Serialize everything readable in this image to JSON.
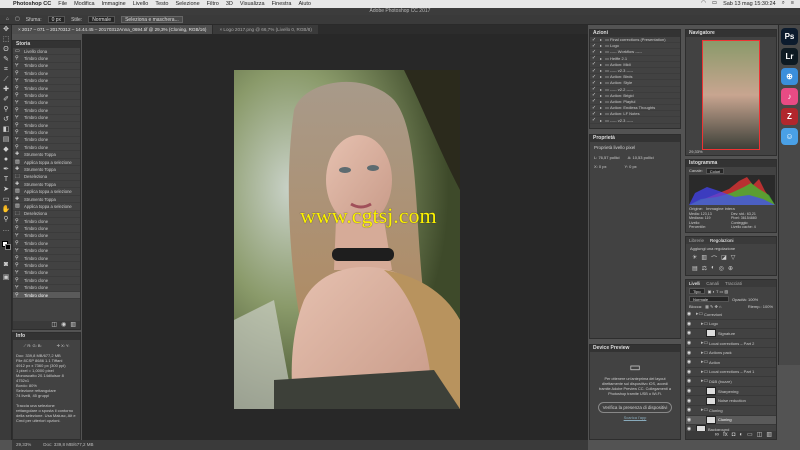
{
  "menubar": {
    "apple": "",
    "app_name": "Photoshop CC",
    "items": [
      "File",
      "Modifica",
      "Immagine",
      "Livello",
      "Testo",
      "Selezione",
      "Filtro",
      "3D",
      "Visualizza",
      "Finestra",
      "Aiuto"
    ],
    "clock": "Sab 13 mag  15:30:24"
  },
  "window_title": "Adobe Photoshop CC 2017",
  "options_bar": {
    "sfuma_label": "Sfuma:",
    "sfuma_value": "0 px",
    "stile_label": "Stile:",
    "stile_value": "Normale",
    "button": "Seleziona e maschera..."
  },
  "doc_tabs": [
    {
      "label": "2017 – 071 – 20170312 – 14.44.45 – 20170312Anna_0694.tif @ 29,3% (Cloning, RGB/16)",
      "active": true
    },
    {
      "label": "Logo 2017.png @ 66,7% (Livello 0, RGB/8)",
      "active": false
    }
  ],
  "history": {
    "title": "Storia",
    "items": [
      "Livello clona",
      "Timbro clone",
      "Timbro clone",
      "Timbro clone",
      "Timbro clone",
      "Timbro clone",
      "Timbro clone",
      "Timbro clone",
      "Timbro clone",
      "Timbro clone",
      "Timbro clone",
      "Timbro clone",
      "Timbro clone",
      "Timbro clone",
      "Strumento Toppa",
      "Applica toppa a selezione",
      "Strumento Toppa",
      "Deseleziona",
      "Strumento Toppa",
      "Applica toppa a selezione",
      "Strumento Toppa",
      "Applica toppa a selezione",
      "Deseleziona",
      "Timbro clone",
      "Timbro clone",
      "Timbro clone",
      "Timbro clone",
      "Timbro clone",
      "Timbro clone",
      "Timbro clone",
      "Timbro clone",
      "Timbro clone",
      "Timbro clone",
      "Timbro clone"
    ]
  },
  "info": {
    "title": "Info",
    "text": "Doc: 339,8 MB/677,2 MB\nFile 8CSP 8686 1.1 Tiffani\n4912 px x 7360 px (300 ppi)\n1 pixel = 1,0000 pixel\nMonoscatto 20.14diluisor 8\n4752x1\nBordo: 80%\nSelezione rettangolare\n74 livelli, 45 gruppi\n\nTraccia una selezione rettangolare o sposta il contorno della selezione. Usa Maiusc, Alt e Cmd per ulteriori opzioni."
  },
  "watermark": "www.cgtsj.com",
  "status": {
    "zoom": "29,33%",
    "doc": "Doc: 339,8 MB/677,2 MB"
  },
  "actions": {
    "title": "Azioni",
    "items": [
      "Final corrections (Presentation)",
      "Logo",
      "----- Workflow -----",
      "Heiffe 2.1",
      "Action: Midi",
      "----- v2.3 -----",
      "Action: Birds",
      "Action: Style",
      "----- v2.2 -----",
      "Action: Brigid",
      "Action: Playful",
      "Action: Endless Thoughts",
      "Action: LF Notes",
      "----- v2.3 -----"
    ]
  },
  "properties": {
    "title": "Proprietà",
    "subtitle": "Proprietà livello pixel",
    "w": "L: 76,57 pollici",
    "h": "A: 10,53 pollici",
    "x": "X: 0 px",
    "y": "Y: 0 px"
  },
  "device_preview": {
    "title": "Device Preview",
    "text": "Per ottenere un'anteprima dei layout direttamente sul dispositivo iOS, accedi tramite Adobe Preview CC. Collegamenti a Photoshop tramite USB o Wi-Fi.",
    "button": "Verifica la presenza di dispositivi",
    "link": "Scarica l'app"
  },
  "navigator": {
    "title": "Navigatore",
    "zoom": "29,33%"
  },
  "histogram": {
    "title": "Istogramma",
    "channel_label": "Canale:",
    "channel": "Colori",
    "origin_label": "Origine:",
    "origin": "Immagine intera",
    "stats": [
      "Media: 123,13",
      "Dev. std.: 63,21",
      "Mediana: 119",
      "Pixel: 36154880",
      "Livello:",
      "Conteggio:",
      "Percentile:",
      "Livello cache: 4"
    ]
  },
  "adjustments": {
    "tabs": [
      "Librerie",
      "Regolazioni"
    ],
    "active": "Regolazioni",
    "label": "Aggiungi una regolazione"
  },
  "layers": {
    "tabs": [
      "Livelli",
      "Canali",
      "Tracciati"
    ],
    "active": "Livelli",
    "kind": "Tipo",
    "blend": "Normale",
    "opacity": "Opacità: 100%",
    "fill": "Riemp.: 100%",
    "lock": "Blocca:",
    "items": [
      {
        "name": "Correzioni",
        "type": "group",
        "indent": 0
      },
      {
        "name": "Logo",
        "type": "group",
        "indent": 1
      },
      {
        "name": "Signature",
        "type": "layer",
        "indent": 2
      },
      {
        "name": "Local corrections – Part 2",
        "type": "group",
        "indent": 1
      },
      {
        "name": "Actions pack",
        "type": "group",
        "indent": 1
      },
      {
        "name": "Action",
        "type": "group",
        "indent": 1
      },
      {
        "name": "Local corrections – Part 1",
        "type": "group",
        "indent": 1
      },
      {
        "name": "D&B (bozze)",
        "type": "group",
        "indent": 1
      },
      {
        "name": "Sharpening",
        "type": "layer",
        "indent": 2
      },
      {
        "name": "Noise reduction",
        "type": "layer",
        "indent": 2
      },
      {
        "name": "Cloning",
        "type": "group",
        "indent": 1
      },
      {
        "name": "Cloning",
        "type": "layer",
        "indent": 2,
        "selected": true
      },
      {
        "name": "Background",
        "type": "layer",
        "indent": 0
      }
    ]
  },
  "dock": {
    "items": [
      {
        "name": "ps-icon",
        "label": "Ps",
        "color": "#0c1b2d"
      },
      {
        "name": "lr-icon",
        "label": "Lr",
        "color": "#0e1a22"
      },
      {
        "name": "safari-icon",
        "label": "⊕",
        "color": "#3b8fdc"
      },
      {
        "name": "itunes-icon",
        "label": "♪",
        "color": "#e84b84"
      },
      {
        "name": "filezilla-icon",
        "label": "Z",
        "color": "#b1272d"
      },
      {
        "name": "finder-icon",
        "label": "☺",
        "color": "#4aa0e6"
      }
    ]
  }
}
